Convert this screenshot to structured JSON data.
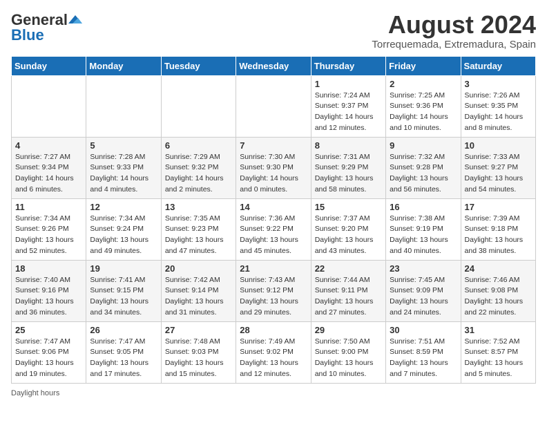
{
  "header": {
    "logo_general": "General",
    "logo_blue": "Blue",
    "title": "August 2024",
    "subtitle": "Torrequemada, Extremadura, Spain"
  },
  "days_of_week": [
    "Sunday",
    "Monday",
    "Tuesday",
    "Wednesday",
    "Thursday",
    "Friday",
    "Saturday"
  ],
  "weeks": [
    [
      {
        "day": "",
        "sunrise": "",
        "sunset": "",
        "daylight": ""
      },
      {
        "day": "",
        "sunrise": "",
        "sunset": "",
        "daylight": ""
      },
      {
        "day": "",
        "sunrise": "",
        "sunset": "",
        "daylight": ""
      },
      {
        "day": "",
        "sunrise": "",
        "sunset": "",
        "daylight": ""
      },
      {
        "day": "1",
        "sunrise": "Sunrise: 7:24 AM",
        "sunset": "Sunset: 9:37 PM",
        "daylight": "Daylight: 14 hours and 12 minutes."
      },
      {
        "day": "2",
        "sunrise": "Sunrise: 7:25 AM",
        "sunset": "Sunset: 9:36 PM",
        "daylight": "Daylight: 14 hours and 10 minutes."
      },
      {
        "day": "3",
        "sunrise": "Sunrise: 7:26 AM",
        "sunset": "Sunset: 9:35 PM",
        "daylight": "Daylight: 14 hours and 8 minutes."
      }
    ],
    [
      {
        "day": "4",
        "sunrise": "Sunrise: 7:27 AM",
        "sunset": "Sunset: 9:34 PM",
        "daylight": "Daylight: 14 hours and 6 minutes."
      },
      {
        "day": "5",
        "sunrise": "Sunrise: 7:28 AM",
        "sunset": "Sunset: 9:33 PM",
        "daylight": "Daylight: 14 hours and 4 minutes."
      },
      {
        "day": "6",
        "sunrise": "Sunrise: 7:29 AM",
        "sunset": "Sunset: 9:32 PM",
        "daylight": "Daylight: 14 hours and 2 minutes."
      },
      {
        "day": "7",
        "sunrise": "Sunrise: 7:30 AM",
        "sunset": "Sunset: 9:30 PM",
        "daylight": "Daylight: 14 hours and 0 minutes."
      },
      {
        "day": "8",
        "sunrise": "Sunrise: 7:31 AM",
        "sunset": "Sunset: 9:29 PM",
        "daylight": "Daylight: 13 hours and 58 minutes."
      },
      {
        "day": "9",
        "sunrise": "Sunrise: 7:32 AM",
        "sunset": "Sunset: 9:28 PM",
        "daylight": "Daylight: 13 hours and 56 minutes."
      },
      {
        "day": "10",
        "sunrise": "Sunrise: 7:33 AM",
        "sunset": "Sunset: 9:27 PM",
        "daylight": "Daylight: 13 hours and 54 minutes."
      }
    ],
    [
      {
        "day": "11",
        "sunrise": "Sunrise: 7:34 AM",
        "sunset": "Sunset: 9:26 PM",
        "daylight": "Daylight: 13 hours and 52 minutes."
      },
      {
        "day": "12",
        "sunrise": "Sunrise: 7:34 AM",
        "sunset": "Sunset: 9:24 PM",
        "daylight": "Daylight: 13 hours and 49 minutes."
      },
      {
        "day": "13",
        "sunrise": "Sunrise: 7:35 AM",
        "sunset": "Sunset: 9:23 PM",
        "daylight": "Daylight: 13 hours and 47 minutes."
      },
      {
        "day": "14",
        "sunrise": "Sunrise: 7:36 AM",
        "sunset": "Sunset: 9:22 PM",
        "daylight": "Daylight: 13 hours and 45 minutes."
      },
      {
        "day": "15",
        "sunrise": "Sunrise: 7:37 AM",
        "sunset": "Sunset: 9:20 PM",
        "daylight": "Daylight: 13 hours and 43 minutes."
      },
      {
        "day": "16",
        "sunrise": "Sunrise: 7:38 AM",
        "sunset": "Sunset: 9:19 PM",
        "daylight": "Daylight: 13 hours and 40 minutes."
      },
      {
        "day": "17",
        "sunrise": "Sunrise: 7:39 AM",
        "sunset": "Sunset: 9:18 PM",
        "daylight": "Daylight: 13 hours and 38 minutes."
      }
    ],
    [
      {
        "day": "18",
        "sunrise": "Sunrise: 7:40 AM",
        "sunset": "Sunset: 9:16 PM",
        "daylight": "Daylight: 13 hours and 36 minutes."
      },
      {
        "day": "19",
        "sunrise": "Sunrise: 7:41 AM",
        "sunset": "Sunset: 9:15 PM",
        "daylight": "Daylight: 13 hours and 34 minutes."
      },
      {
        "day": "20",
        "sunrise": "Sunrise: 7:42 AM",
        "sunset": "Sunset: 9:14 PM",
        "daylight": "Daylight: 13 hours and 31 minutes."
      },
      {
        "day": "21",
        "sunrise": "Sunrise: 7:43 AM",
        "sunset": "Sunset: 9:12 PM",
        "daylight": "Daylight: 13 hours and 29 minutes."
      },
      {
        "day": "22",
        "sunrise": "Sunrise: 7:44 AM",
        "sunset": "Sunset: 9:11 PM",
        "daylight": "Daylight: 13 hours and 27 minutes."
      },
      {
        "day": "23",
        "sunrise": "Sunrise: 7:45 AM",
        "sunset": "Sunset: 9:09 PM",
        "daylight": "Daylight: 13 hours and 24 minutes."
      },
      {
        "day": "24",
        "sunrise": "Sunrise: 7:46 AM",
        "sunset": "Sunset: 9:08 PM",
        "daylight": "Daylight: 13 hours and 22 minutes."
      }
    ],
    [
      {
        "day": "25",
        "sunrise": "Sunrise: 7:47 AM",
        "sunset": "Sunset: 9:06 PM",
        "daylight": "Daylight: 13 hours and 19 minutes."
      },
      {
        "day": "26",
        "sunrise": "Sunrise: 7:47 AM",
        "sunset": "Sunset: 9:05 PM",
        "daylight": "Daylight: 13 hours and 17 minutes."
      },
      {
        "day": "27",
        "sunrise": "Sunrise: 7:48 AM",
        "sunset": "Sunset: 9:03 PM",
        "daylight": "Daylight: 13 hours and 15 minutes."
      },
      {
        "day": "28",
        "sunrise": "Sunrise: 7:49 AM",
        "sunset": "Sunset: 9:02 PM",
        "daylight": "Daylight: 13 hours and 12 minutes."
      },
      {
        "day": "29",
        "sunrise": "Sunrise: 7:50 AM",
        "sunset": "Sunset: 9:00 PM",
        "daylight": "Daylight: 13 hours and 10 minutes."
      },
      {
        "day": "30",
        "sunrise": "Sunrise: 7:51 AM",
        "sunset": "Sunset: 8:59 PM",
        "daylight": "Daylight: 13 hours and 7 minutes."
      },
      {
        "day": "31",
        "sunrise": "Sunrise: 7:52 AM",
        "sunset": "Sunset: 8:57 PM",
        "daylight": "Daylight: 13 hours and 5 minutes."
      }
    ]
  ],
  "footer": {
    "note": "Daylight hours"
  }
}
